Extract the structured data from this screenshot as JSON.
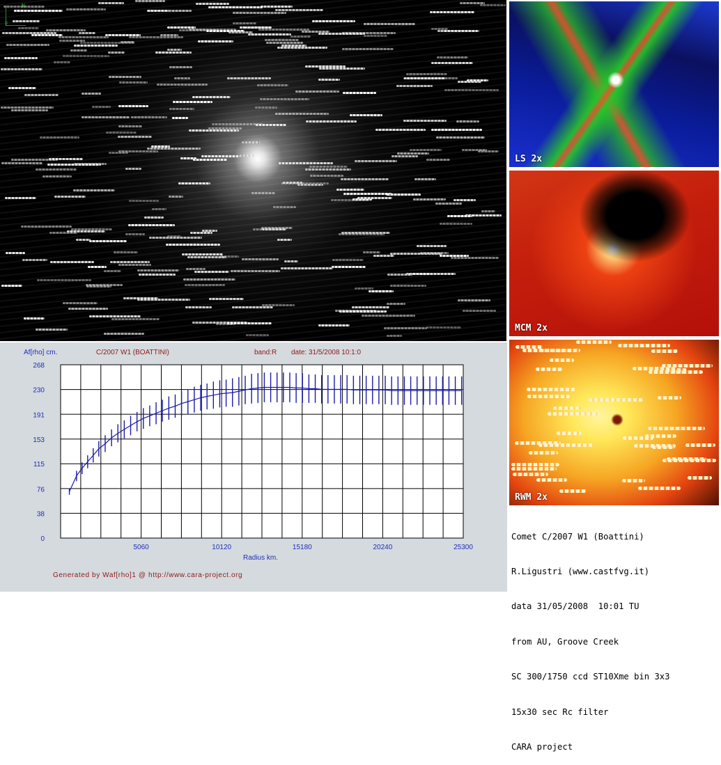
{
  "panels": [
    {
      "label": "LS 2x"
    },
    {
      "label": "MCM 2x"
    },
    {
      "label": "RWM 2x"
    }
  ],
  "caption": {
    "lines": [
      "Comet C/2007 W1 (Boattini)",
      "R.Ligustri (www.castfvg.it)",
      "data 31/05/2008  10:01 TU",
      "from AU, Groove Creek",
      "SC 300/1750 ccd ST10Xme bin 3x3",
      "15x30 sec Rc filter",
      "CARA project"
    ]
  },
  "colors": {
    "chart_bg": "#d5dade",
    "plot_bg": "#ffffff",
    "grid": "#000000",
    "series": "#1a1aa8",
    "title_red": "#8b1a1a",
    "axis_text_blue": "#1f2fb8"
  },
  "chart_data": {
    "type": "line",
    "ylabel": "Af[rho] cm.",
    "title_object": "C/2007 W1 (BOATTINI)",
    "title_band": "band:R",
    "title_date": "date: 31/5/2008 10:1:0",
    "xlabel": "Radius km.",
    "footer": "Generated by Waf[rho]1 @ http://www.cara-project.org",
    "xlim": [
      0,
      25300
    ],
    "ylim": [
      0,
      268
    ],
    "xticks": [
      "5060",
      "10120",
      "15180",
      "20240",
      "25300"
    ],
    "xtick_values": [
      5060,
      10120,
      15180,
      20240,
      25300
    ],
    "yticks": [
      "0",
      "38",
      "76",
      "115",
      "153",
      "191",
      "230",
      "268"
    ],
    "ytick_values": [
      0,
      38,
      76,
      115,
      153,
      191,
      230,
      268
    ],
    "grid": true,
    "x_grid_lines": 20,
    "y_grid_lines": 7,
    "series": [
      {
        "x": [
          550,
          1000,
          1350,
          1700,
          2050,
          2400,
          2800,
          3200,
          3600,
          4000,
          4400,
          4800,
          5200,
          5600,
          6000,
          6400,
          6800,
          7200,
          7600,
          8000,
          8400,
          8800,
          9200,
          9600,
          10000,
          10400,
          10800,
          11200,
          11600,
          12000,
          12400,
          12800,
          13200,
          13600,
          14000,
          14400,
          14800,
          15200,
          15600,
          16000,
          16400,
          16800,
          17200,
          17600,
          18000,
          18400,
          18800,
          19200,
          19600,
          20000,
          20400,
          20800,
          21200,
          21600,
          22000,
          22400,
          22800,
          23200,
          23600,
          24000,
          24400,
          24800,
          25200
        ],
        "values": [
          72,
          96,
          108,
          118,
          128,
          138,
          146,
          155,
          162,
          168,
          174,
          180,
          185,
          189,
          193,
          197,
          201,
          204,
          208,
          211,
          214,
          217,
          219,
          221,
          223,
          224,
          225,
          227,
          229,
          231,
          232,
          233,
          233,
          233,
          233,
          233,
          232,
          232,
          231,
          231,
          230,
          230,
          230,
          230,
          230,
          229,
          229,
          229,
          229,
          229,
          229,
          228,
          228,
          228,
          228,
          228,
          228,
          228,
          228,
          228,
          228,
          228,
          228
        ],
        "errors": [
          5,
          8,
          9,
          10,
          11,
          12,
          13,
          13,
          14,
          14,
          15,
          15,
          16,
          16,
          17,
          17,
          18,
          18,
          19,
          19,
          20,
          20,
          20,
          21,
          21,
          21,
          22,
          22,
          22,
          23,
          23,
          23,
          23,
          23,
          23,
          23,
          23,
          23,
          22,
          22,
          22,
          22,
          22,
          22,
          22,
          22,
          22,
          22,
          22,
          22,
          22,
          22,
          22,
          22,
          22,
          22,
          22,
          22,
          22,
          22,
          22,
          22,
          22
        ]
      }
    ]
  }
}
